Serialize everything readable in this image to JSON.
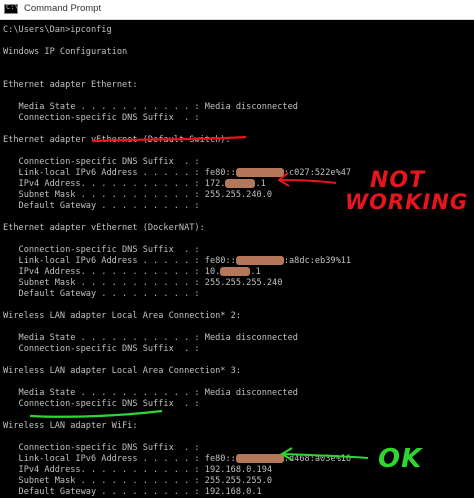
{
  "window": {
    "title": "Command Prompt"
  },
  "console": {
    "lines": [
      "C:\\Users\\Dan>ipconfig",
      "",
      "Windows IP Configuration",
      "",
      "",
      "Ethernet adapter Ethernet:",
      "",
      "   Media State . . . . . . . . . . . : Media disconnected",
      "   Connection-specific DNS Suffix  . :",
      "",
      "Ethernet adapter vEthernet (Default Switch):",
      "",
      "   Connection-specific DNS Suffix  . :",
      "   Link-local IPv6 Address . . . . . : fe80::|BLOT|:c027:522e%47",
      "   IPv4 Address. . . . . . . . . . . : 172.|BLOT|.1",
      "   Subnet Mask . . . . . . . . . . . : 255.255.240.0",
      "   Default Gateway . . . . . . . . . :",
      "",
      "Ethernet adapter vEthernet (DockerNAT):",
      "",
      "   Connection-specific DNS Suffix  . :",
      "   Link-local IPv6 Address . . . . . : fe80::|BLOT|:a8dc:eb39%11",
      "   IPv4 Address. . . . . . . . . . . : 10.|BLOT|.1",
      "   Subnet Mask . . . . . . . . . . . : 255.255.255.240",
      "   Default Gateway . . . . . . . . . :",
      "",
      "Wireless LAN adapter Local Area Connection* 2:",
      "",
      "   Media State . . . . . . . . . . . : Media disconnected",
      "   Connection-specific DNS Suffix  . :",
      "",
      "Wireless LAN adapter Local Area Connection* 3:",
      "",
      "   Media State . . . . . . . . . . . : Media disconnected",
      "   Connection-specific DNS Suffix  . :",
      "",
      "Wireless LAN adapter WiFi:",
      "",
      "   Connection-specific DNS Suffix  . :",
      "   Link-local IPv6 Address . . . . . : fe80::|BLOT|:d468:a03e%16",
      "   IPv4 Address. . . . . . . . . . . : 192.168.0.194",
      "   Subnet Mask . . . . . . . . . . . : 255.255.255.0",
      "   Default Gateway . . . . . . . . . : 192.168.0.1"
    ]
  },
  "annotations": {
    "not_working_line1": "NOT",
    "not_working_line2": "WORKING",
    "ok": "OK",
    "red_color": "#e8141e",
    "green_color": "#2fd62f"
  },
  "colors": {
    "console_bg": "#000000",
    "console_text": "#c0c0c0",
    "redaction": "#b5775a"
  }
}
